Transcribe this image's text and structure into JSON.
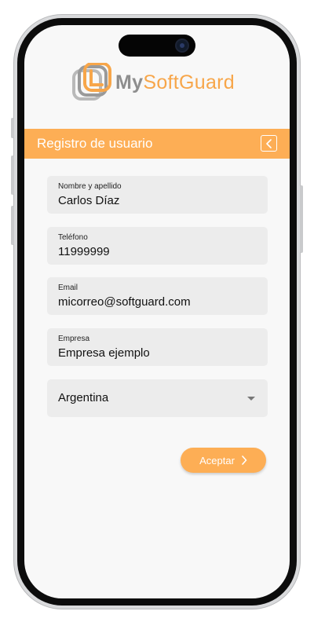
{
  "app": {
    "logo_my": "My",
    "logo_rest": "SoftGuard"
  },
  "header": {
    "title": "Registro de usuario",
    "back_icon": "chevron-left-icon"
  },
  "form": {
    "name": {
      "label": "Nombre y apellido",
      "value": "Carlos Díaz"
    },
    "phone": {
      "label": "Teléfono",
      "value": "11999999"
    },
    "email": {
      "label": "Email",
      "value": "micorreo@softguard.com"
    },
    "company": {
      "label": "Empresa",
      "value": "Empresa ejemplo"
    },
    "country": {
      "selected": "Argentina",
      "icon": "caret-down-icon"
    }
  },
  "actions": {
    "accept_label": "Aceptar",
    "accept_icon": "chevron-right-icon"
  },
  "colors": {
    "accent": "#fdae55",
    "field_bg": "#ececec",
    "screen_bg": "#f8f8f8"
  }
}
